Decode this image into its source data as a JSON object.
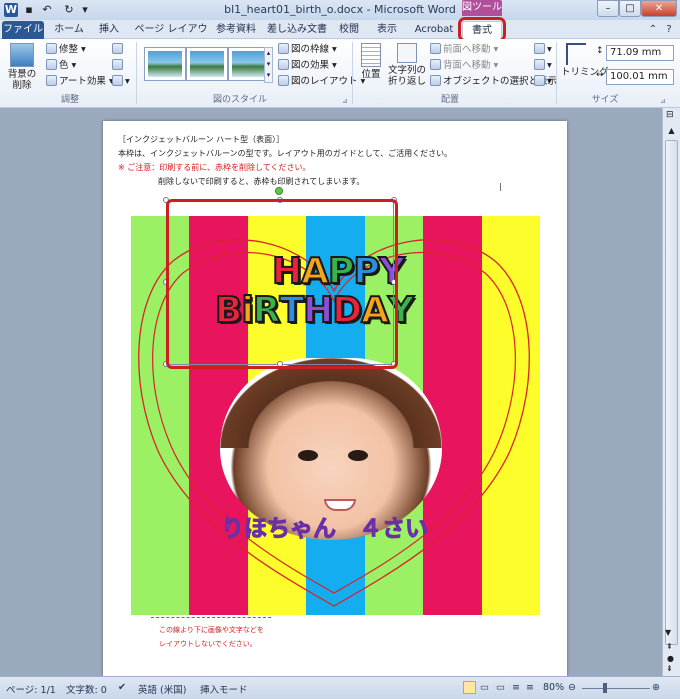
{
  "titlebar": {
    "title": "bl1_heart01_birth_o.docx - Microsoft Word",
    "tool_tab_label": "図ツール"
  },
  "tabs": [
    {
      "label": "ファイル"
    },
    {
      "label": "ホーム"
    },
    {
      "label": "挿入"
    },
    {
      "label": "ページ レイアウト"
    },
    {
      "label": "参考資料"
    },
    {
      "label": "差し込み文書"
    },
    {
      "label": "校閲"
    },
    {
      "label": "表示"
    },
    {
      "label": "Acrobat"
    },
    {
      "label": "書式"
    }
  ],
  "ribbon": {
    "adjust": {
      "remove_bg_label": "背景の\n削除",
      "corrections": "修整",
      "color": "色",
      "artistic": "アート効果",
      "group_label": "調整"
    },
    "styles": {
      "border": "図の枠線",
      "effects": "図の効果",
      "layout": "図のレイアウト",
      "group_label": "図のスタイル"
    },
    "arrange": {
      "position": "位置",
      "wrap": "文字列の\n折り返し",
      "bring_forward": "前面へ移動",
      "send_backward": "背面へ移動",
      "selection_pane": "オブジェクトの選択と表示",
      "group_label": "配置"
    },
    "size": {
      "crop": "トリミング",
      "height": "71.09 mm",
      "width": "100.01 mm",
      "group_label": "サイズ"
    }
  },
  "document": {
    "line1": "［インクジェットバルーン ハート型（表面）］",
    "line2": "本枠は、インクジェットバルーンの型です。レイアウト用のガイドとして、ご活用ください。",
    "line3": "※ ご注意：印刷する前に、赤枠を削除してください。",
    "line4": "削除しないで印刷すると、赤枠も印刷されてしまいます。",
    "happy": "HAPPY",
    "birthday": "BiRTHDAY",
    "name_text": "りほちゃん　４さい",
    "footer1": "この線より下に画像や文字などを",
    "footer2": "レイアウトしないでください。"
  },
  "statusbar": {
    "page": "ページ: 1/1",
    "words": "文字数: 0",
    "lang": "英語 (米国)",
    "mode": "挿入モード",
    "zoom": "80%"
  },
  "colors": {
    "stripes": [
      "#9cf063",
      "#e8155e",
      "#fcfd2b",
      "#14aef0",
      "#9cf063",
      "#e8155e",
      "#fcfd2b"
    ],
    "heart": "#d8242b",
    "highlight": "#cc1f1f",
    "name": "#9b4fd6"
  }
}
